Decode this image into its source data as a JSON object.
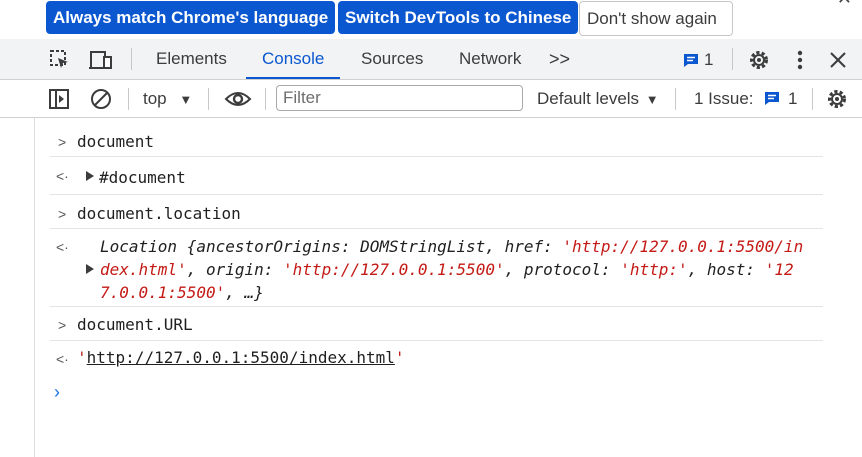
{
  "banner": {
    "match_language": "Always match Chrome's language",
    "switch_chinese": "Switch DevTools to Chinese",
    "dont_show": "Don't show again"
  },
  "tabs": {
    "items": [
      "Elements",
      "Console",
      "Sources",
      "Network"
    ],
    "active": "Console",
    "more": ">>",
    "message_count": "1"
  },
  "toolbar": {
    "context": "top",
    "filter_placeholder": "Filter",
    "levels": "Default levels",
    "issues_label": "1 Issue:",
    "issues_count": "1"
  },
  "console": {
    "entries": [
      {
        "input": "document"
      },
      {
        "output": "#document"
      },
      {
        "input": "document.location"
      },
      {
        "output_lines": [
          "Location {ancestorOrigins: DOMStringList, href: 'http://127.0.0.1:5500/in",
          "dex.html', origin: 'http://127.0.0.1:5500', protocol: 'http:', host: '12",
          "7.0.0.1:5500', …}"
        ]
      },
      {
        "input": "document.URL"
      },
      {
        "output": "'http://127.0.0.1:5500/index.html'"
      }
    ]
  },
  "colors": {
    "accent": "#0b57d0",
    "string": "#c41a16"
  }
}
